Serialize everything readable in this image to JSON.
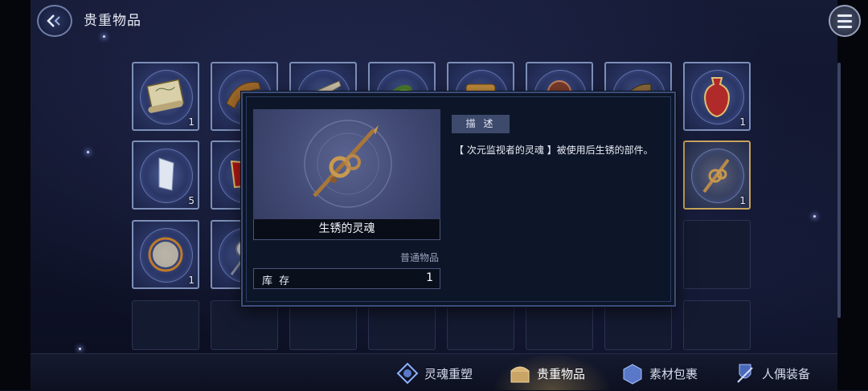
{
  "header": {
    "title": "贵重物品",
    "back_icon": "back-arrow-icon",
    "menu_icon": "hamburger-menu-icon"
  },
  "grid": {
    "rows": [
      [
        {
          "item": "scroll-icon",
          "count": "1"
        },
        {
          "item": "horn-icon",
          "count": ""
        },
        {
          "item": "bone-icon",
          "count": ""
        },
        {
          "item": "leaf-icon",
          "count": ""
        },
        {
          "item": "scroll-roll-icon",
          "count": ""
        },
        {
          "item": "orb-icon",
          "count": ""
        },
        {
          "item": "pipe-icon",
          "count": ""
        },
        {
          "item": "vase-icon",
          "count": "1"
        }
      ],
      [
        {
          "item": "crystal-icon",
          "count": "5"
        },
        {
          "item": "red-gem-icon",
          "count": ""
        },
        {
          "item": "",
          "count": ""
        },
        {
          "item": "",
          "count": ""
        },
        {
          "item": "",
          "count": ""
        },
        {
          "item": "",
          "count": ""
        },
        {
          "item": "",
          "count": ""
        },
        {
          "item": "rusty-soul-icon",
          "count": "1",
          "selected": true
        }
      ],
      [
        {
          "item": "glowing-orb-icon",
          "count": "1"
        },
        {
          "item": "compass-icon",
          "count": ""
        }
      ]
    ]
  },
  "popup": {
    "item_name": "生锈的灵魂",
    "item_type": "普通物品",
    "stock_label": "库 存",
    "stock_value": "1",
    "desc_tab": "描 述",
    "description": "【 次元监视者的灵魂 】被使用后生锈的部件。"
  },
  "bottom_nav": {
    "items": [
      {
        "label": "灵魂重塑",
        "icon": "soul-reshape-icon",
        "active": false
      },
      {
        "label": "贵重物品",
        "icon": "treasure-chest-icon",
        "active": true
      },
      {
        "label": "素材包裹",
        "icon": "material-box-icon",
        "active": false
      },
      {
        "label": "人偶装备",
        "icon": "puppet-equipment-icon",
        "active": false
      }
    ]
  },
  "colors": {
    "accent_gold": "#c7a45c",
    "slot_border": "#7d8fb8",
    "popup_bg": "#0d1628"
  }
}
